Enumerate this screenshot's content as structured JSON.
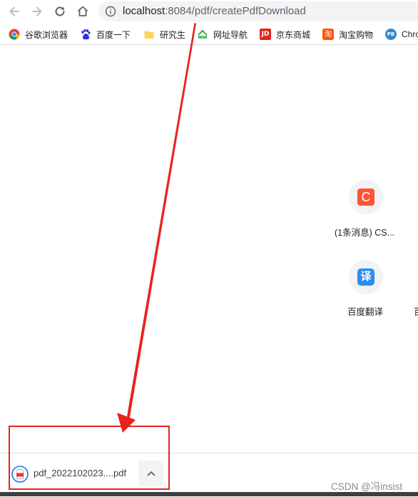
{
  "omnibox": {
    "host": "localhost",
    "path": ":8084/pdf/createPdfDownload"
  },
  "bookmarks": [
    {
      "label": "谷歌浏览器",
      "icon": "chrome-icon"
    },
    {
      "label": "百度一下",
      "icon": "baidu-paw-icon"
    },
    {
      "label": "研究生",
      "icon": "folder-icon"
    },
    {
      "label": "网址导航",
      "icon": "2345-icon"
    },
    {
      "label": "京东商城",
      "icon": "jd-icon",
      "icon_text": "JD"
    },
    {
      "label": "淘宝购物",
      "icon": "taobao-icon",
      "icon_text": "淘"
    },
    {
      "label": "Chro",
      "icon": "pb-icon",
      "icon_text": "PB"
    }
  ],
  "shortcuts": [
    {
      "label": "(1条消息) CS...",
      "icon": "csdn-icon",
      "icon_text": "C",
      "color": "#fc5531"
    },
    {
      "label": "百度翻译",
      "icon": "baidu-translate-icon",
      "icon_text": "译",
      "color": "#2d8cf0"
    },
    {
      "label": "百",
      "icon": "partial-shortcut"
    }
  ],
  "download": {
    "filename": "pdf_2022102023....pdf",
    "file_icon_text": "PDF"
  },
  "watermark": "CSDN @冯insist",
  "annotation": {
    "color": "#e8231f"
  }
}
